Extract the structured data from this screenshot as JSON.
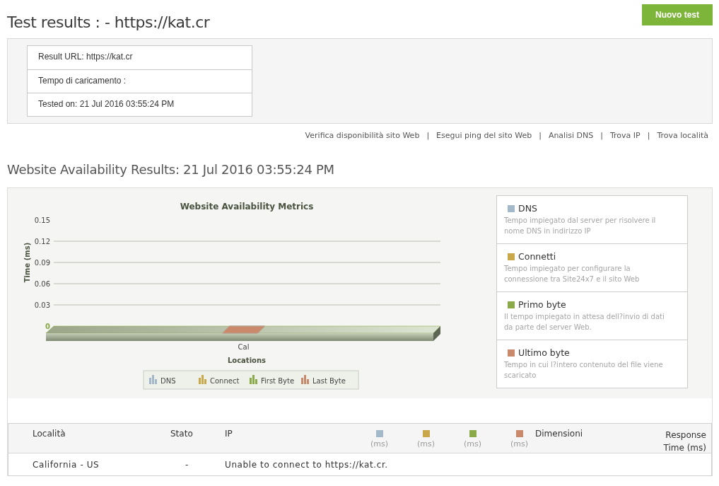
{
  "header": {
    "title": "Test results : - https://kat.cr",
    "new_test_button": "Nuovo test"
  },
  "summary": {
    "rows": [
      "Result URL: https://kat.cr",
      "Tempo di caricamento :",
      "Tested on: 21 Jul 2016 03:55:24 PM"
    ]
  },
  "links": [
    "Verifica disponibilità sito Web",
    "Esegui ping del sito Web",
    "Analisi DNS",
    "Trova IP",
    "Trova località"
  ],
  "link_separators": [
    "|",
    "|",
    "|",
    "|"
  ],
  "availability": {
    "heading": "Website Availability Results: 21 Jul 2016 03:55:24 PM",
    "chart_data": {
      "type": "bar",
      "title": "Website Availability Metrics",
      "xlabel": "Locations",
      "ylabel": "Time (ms)",
      "categories": [
        "Cal"
      ],
      "stacked": true,
      "grid": true,
      "legend": "bottom",
      "ylim": [
        0,
        0.15
      ],
      "yticks": [
        0,
        0.03,
        0.06,
        0.09,
        0.12,
        0.15
      ],
      "series": [
        {
          "name": "DNS",
          "color": "#a3b8c8",
          "values": [
            0
          ]
        },
        {
          "name": "Connect",
          "color": "#c9a84c",
          "values": [
            0
          ]
        },
        {
          "name": "First Byte",
          "color": "#8aaa4a",
          "values": [
            0
          ]
        },
        {
          "name": "Last Byte",
          "color": "#c9896a",
          "values": [
            0
          ]
        }
      ]
    },
    "metric_cards": [
      {
        "title": "DNS",
        "color": "#a3b8c8",
        "description": "Tempo impiegato dal server per risolvere il nome DNS in indirizzo IP"
      },
      {
        "title": "Connetti",
        "color": "#c9a84c",
        "description": "Tempo impiegato per configurare la connessione tra Site24x7 e il sito Web"
      },
      {
        "title": "Primo byte",
        "color": "#8aaa4a",
        "description": "Il tempo impiegato in attesa dell?invio di dati da parte del server Web."
      },
      {
        "title": "Ultimo byte",
        "color": "#c9896a",
        "description": "Tempo in cui l?intero contenuto del file viene scaricato"
      }
    ]
  },
  "results_table": {
    "columns": [
      {
        "kind": "text",
        "label": "Località"
      },
      {
        "kind": "text",
        "label": "Stato"
      },
      {
        "kind": "text",
        "label": "IP"
      },
      {
        "kind": "metric",
        "color": "#a3b8c8",
        "label": "(ms)"
      },
      {
        "kind": "metric",
        "color": "#c9a84c",
        "label": "(ms)"
      },
      {
        "kind": "metric",
        "color": "#8aaa4a",
        "label": "(ms)"
      },
      {
        "kind": "metric",
        "color": "#c9896a",
        "label": "(ms)"
      },
      {
        "kind": "text",
        "label": "Dimensioni"
      },
      {
        "kind": "right",
        "label": "Response Time (ms)"
      }
    ],
    "rows": [
      {
        "cells": [
          "California - US",
          "-",
          "Unable to connect to https://kat.cr."
        ]
      }
    ]
  }
}
